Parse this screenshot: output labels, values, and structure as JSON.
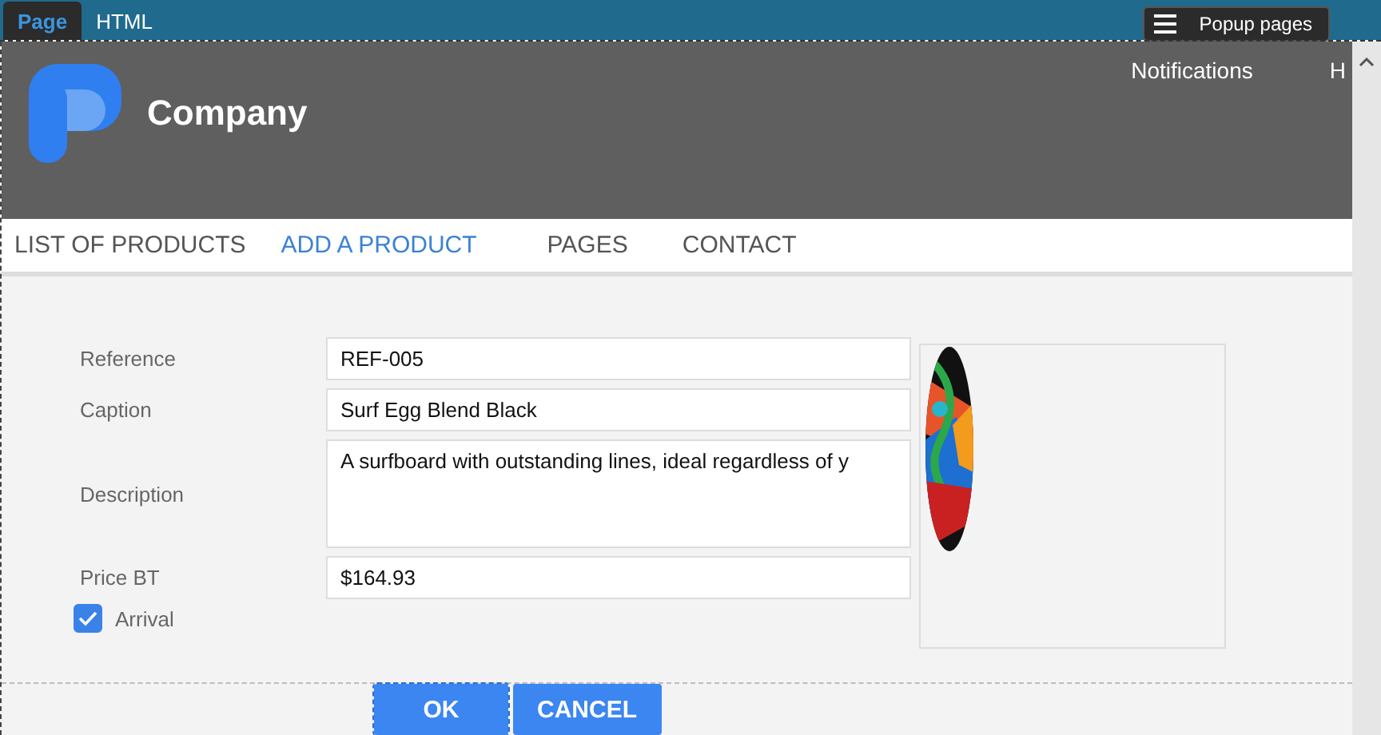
{
  "editor_tabs": [
    {
      "label": "Page",
      "selected": true
    },
    {
      "label": "HTML",
      "selected": false
    }
  ],
  "popup_button": {
    "label": "Popup pages"
  },
  "header": {
    "company": "Company",
    "links": [
      "Notifications",
      "H"
    ]
  },
  "nav": [
    {
      "label": "LIST OF PRODUCTS",
      "selected": false
    },
    {
      "label": "ADD A PRODUCT",
      "selected": true
    },
    {
      "label": "PAGES",
      "selected": false
    },
    {
      "label": "CONTACT",
      "selected": false
    }
  ],
  "form": {
    "fields": [
      {
        "label": "Reference",
        "value": "REF-005",
        "kind": "line"
      },
      {
        "label": "Caption",
        "value": "Surf Egg Blend Black",
        "kind": "line"
      },
      {
        "label": "Description",
        "value": "A surfboard with outstanding lines, ideal regardless of y",
        "kind": "area"
      },
      {
        "label": "Price BT",
        "value": "$164.93",
        "kind": "line"
      }
    ],
    "arrival": {
      "label": "Arrival",
      "checked": true
    }
  },
  "buttons": [
    "OK",
    "CANCEL"
  ]
}
